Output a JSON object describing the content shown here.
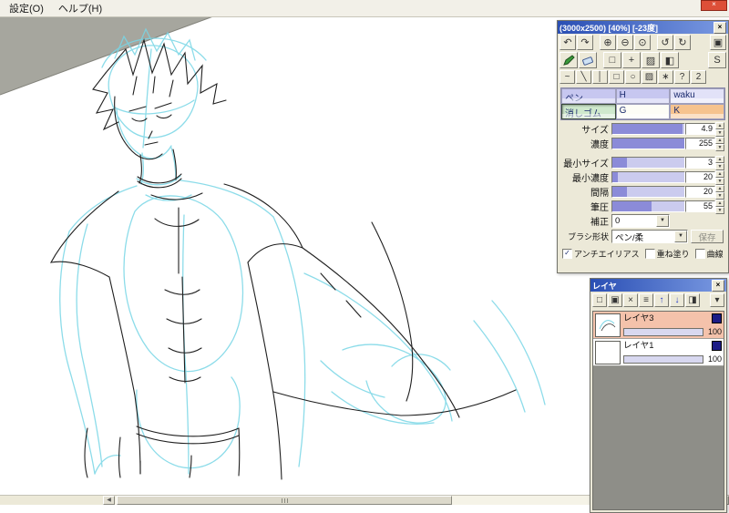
{
  "window": {
    "close_glyph": "×"
  },
  "icons": {
    "close": "×",
    "spin_up": "▲",
    "spin_down": "▼",
    "dropdown": "▼",
    "scroll_left": "◀",
    "scroll_right": "▶"
  },
  "menu": {
    "items": [
      {
        "label": "設定(O)"
      },
      {
        "label": "ヘルプ(H)"
      }
    ]
  },
  "tool_panel": {
    "title": "(3000x2500) [40%] [-23度]",
    "nav": [
      {
        "name": "undo",
        "glyph": "↶"
      },
      {
        "name": "redo",
        "glyph": "↷"
      },
      {
        "name": "zoom-in",
        "glyph": "⊕"
      },
      {
        "name": "zoom-out",
        "glyph": "⊖"
      },
      {
        "name": "zoom-reset",
        "glyph": "⊙"
      },
      {
        "name": "rotate-ccw",
        "glyph": "↺"
      },
      {
        "name": "rotate-cw",
        "glyph": "↻"
      },
      {
        "name": "view-reset",
        "glyph": "▣"
      }
    ],
    "tools": [
      {
        "name": "select",
        "glyph": "□"
      },
      {
        "name": "move",
        "glyph": "+"
      },
      {
        "name": "fill",
        "glyph": "▨"
      },
      {
        "name": "gradient",
        "glyph": "◧"
      },
      {
        "name": "transform",
        "glyph": "S"
      }
    ],
    "shapes": [
      {
        "name": "freehand",
        "glyph": "~"
      },
      {
        "name": "line",
        "glyph": "╲"
      },
      {
        "name": "polyline",
        "glyph": "│"
      },
      {
        "name": "rect",
        "glyph": "□"
      },
      {
        "name": "ellipse",
        "glyph": "○"
      },
      {
        "name": "fill-rect",
        "glyph": "▨"
      },
      {
        "name": "spray",
        "glyph": "∗"
      },
      {
        "name": "help",
        "glyph": "?"
      },
      {
        "name": "curve",
        "glyph": "2"
      }
    ],
    "slots": [
      {
        "label": "ペン"
      },
      {
        "label": "H"
      },
      {
        "label": "waku"
      },
      {
        "label": "消しゴム"
      },
      {
        "label": "G"
      },
      {
        "label": "K"
      }
    ],
    "sliders": [
      {
        "label": "サイズ",
        "value": "4.9",
        "fill_style": "width:97%"
      },
      {
        "label": "濃度",
        "value": "255",
        "fill_style": "width:100%"
      },
      {
        "label": "最小サイズ",
        "value": "3",
        "fill_style": "width:20%"
      },
      {
        "label": "最小濃度",
        "value": "20",
        "fill_style": "width:8%"
      },
      {
        "label": "間隔",
        "value": "20",
        "fill_style": "width:20%"
      },
      {
        "label": "筆圧",
        "value": "55",
        "fill_style": "width:55%"
      }
    ],
    "correction": {
      "label": "補正",
      "value": "0"
    },
    "brush_shape": {
      "label": "ブラシ形状",
      "value": "ペン/柔",
      "save_label": "保存"
    },
    "checkboxes": [
      {
        "label": "アンチエイリアス",
        "mark": "✓"
      },
      {
        "label": "重ね塗り",
        "mark": ""
      },
      {
        "label": "曲線",
        "mark": ""
      }
    ]
  },
  "layer_panel": {
    "title": "レイヤ",
    "buttons": [
      {
        "name": "new-layer",
        "glyph": "□"
      },
      {
        "name": "duplicate-layer",
        "glyph": "▣"
      },
      {
        "name": "delete-layer",
        "glyph": "×"
      },
      {
        "name": "merge-layer",
        "glyph": "≡"
      },
      {
        "name": "layer-up",
        "glyph": "↑"
      },
      {
        "name": "layer-down",
        "glyph": "↓"
      },
      {
        "name": "layer-mask",
        "glyph": "◨"
      },
      {
        "name": "layer-menu",
        "glyph": "▾"
      }
    ],
    "layers": [
      {
        "name": "レイヤ3",
        "opacity": "100",
        "bar_style": "width:100%"
      },
      {
        "name": "レイヤ1",
        "opacity": "100",
        "bar_style": "width:100%"
      }
    ]
  },
  "colors": {
    "titlebar_blue": "#2a4fb4",
    "accent_fill": "#8b8bd8",
    "selected_layer": "#f4c2ab",
    "slot_pen": "#c7c7f0",
    "slot_eraser": "#cfe9cd",
    "slot_k": "#f6c38e",
    "sketch_cyan": "#79d6e6",
    "sketch_black": "#1f1f1f",
    "outside_canvas_gray": "#a6a69e",
    "window_close_red": "#dd4f38"
  }
}
